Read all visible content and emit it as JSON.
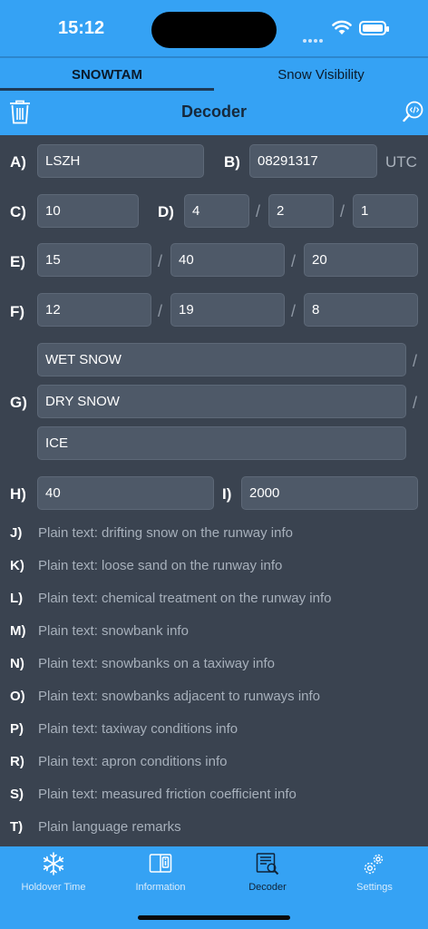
{
  "status": {
    "time": "15:12"
  },
  "segments": [
    "SNOWTAM",
    "Snow Visibility"
  ],
  "nav": {
    "title": "Decoder",
    "trash_icon": "trash-icon",
    "search_icon": "search-code-icon"
  },
  "form": {
    "A": {
      "label": "A)",
      "value": "LSZH"
    },
    "B": {
      "label": "B)",
      "value": "08291317",
      "suffix": "UTC"
    },
    "C": {
      "label": "C)",
      "value": "10"
    },
    "D": {
      "label": "D)",
      "values": [
        "4",
        "2",
        "1"
      ]
    },
    "E": {
      "label": "E)",
      "values": [
        "15",
        "40",
        "20"
      ]
    },
    "F": {
      "label": "F)",
      "values": [
        "12",
        "19",
        "8"
      ]
    },
    "G": {
      "label": "G)",
      "values": [
        "WET SNOW",
        "DRY SNOW",
        "ICE"
      ]
    },
    "H": {
      "label": "H)",
      "value": "40"
    },
    "I": {
      "label": "I)",
      "value": "2000"
    },
    "slash": "/"
  },
  "plain": [
    {
      "label": "J)",
      "text": "Plain text: drifting snow on the runway info"
    },
    {
      "label": "K)",
      "text": "Plain text: loose sand on the runway info"
    },
    {
      "label": "L)",
      "text": "Plain text: chemical treatment on the runway info"
    },
    {
      "label": "M)",
      "text": "Plain text: snowbank info"
    },
    {
      "label": "N)",
      "text": "Plain text: snowbanks on a taxiway info"
    },
    {
      "label": "O)",
      "text": "Plain text: snowbanks adjacent to runways info"
    },
    {
      "label": "P)",
      "text": "Plain text: taxiway conditions info"
    },
    {
      "label": "R)",
      "text": "Plain text: apron conditions info"
    },
    {
      "label": "S)",
      "text": "Plain text: measured friction coefficient info"
    },
    {
      "label": "T)",
      "text": "Plain language remarks"
    }
  ],
  "tabbar": [
    {
      "label": "Holdover Time",
      "icon": "snowflake-icon"
    },
    {
      "label": "Information",
      "icon": "book-icon"
    },
    {
      "label": "Decoder",
      "icon": "document-search-icon",
      "active": true
    },
    {
      "label": "Settings",
      "icon": "gears-icon"
    }
  ],
  "colors": {
    "accent": "#35a2f4",
    "background": "#3a4350",
    "field": "#4e5968"
  }
}
